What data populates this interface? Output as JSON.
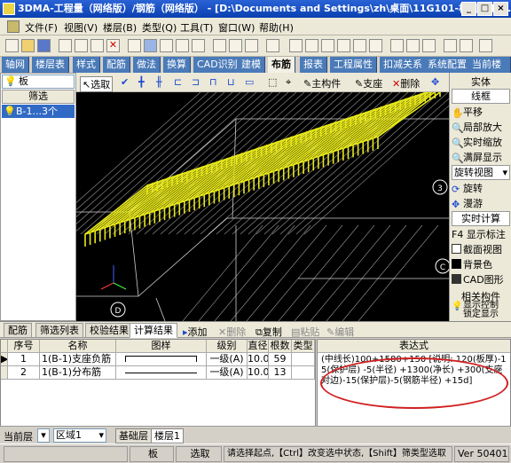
{
  "window": {
    "title": "3DMA-工程量（网络版）/钢筋（网络版） - [D:\\Documents and Settings\\zh\\桌面\\11G101-板测试工程..."
  },
  "menu": [
    "文件(F)",
    "视图(V)",
    "楼层(B)",
    "类型(Q)",
    "工具(T)",
    "窗口(W)",
    "帮助(H)"
  ],
  "tabs": [
    "轴网",
    "楼层表",
    "样式",
    "配筋",
    "做法",
    "换算",
    "CAD识别",
    "建模",
    "布筋",
    "报表",
    "工程属性",
    "扣减关系",
    "系统配置",
    "当前楼"
  ],
  "active_tab": "布筋",
  "left": {
    "combo": "板",
    "filter_label": "筛选",
    "item": "B-1...3个"
  },
  "draw_toolbar": {
    "select": "选取",
    "main_rebar": "主构件",
    "support": "支座",
    "delete": "删除"
  },
  "right_panel": {
    "entity_label": "实体",
    "mode": "线框",
    "tools": [
      "平移",
      "局部放大",
      "实时缩放",
      "满屏显示"
    ],
    "rotate_view": "旋转视图",
    "rotate": "旋转",
    "roam": "漫游",
    "realtime_calc": "实时计算",
    "show_label": "F4 显示标注",
    "section_view": "截面视图",
    "bg_color": "背景色",
    "cad_figure": "CAD图形",
    "related": "相关构件",
    "display_control": "显示控制",
    "lock_display": "锁定显示"
  },
  "viewport": {
    "axis_labels": [
      "3",
      "C",
      "D"
    ]
  },
  "bottom": {
    "tabs": [
      "配筋",
      "筛选列表",
      "校验结果",
      "计算结果"
    ],
    "active_tab": "计算结果",
    "actions": [
      "添加",
      "删除",
      "复制",
      "粘贴",
      "编辑"
    ],
    "columns": [
      "序号",
      "名称",
      "图样",
      "级别",
      "直径",
      "根数",
      "类型"
    ],
    "rows": [
      {
        "no": "1",
        "name": "1(B-1)支座负筋",
        "level": "一级(A)",
        "dia": "10.0",
        "count": "59",
        "type": ""
      },
      {
        "no": "2",
        "name": "1(B-1)分布筋",
        "level": "一级(A)",
        "dia": "10.0",
        "count": "13",
        "type": ""
      }
    ],
    "expr_header": "表达式",
    "expr_text": "(中线长)100+1580+150 [说明: 120(板厚)-15(保护层) -5(半径) +1300(净长) +300(支座对边)-15(保护层)-5(钢筋半径) +15d]"
  },
  "layer_bar": {
    "current_label": "当前层",
    "current_value": "",
    "region": "区域1",
    "tabs": [
      "基础层",
      "楼层1"
    ]
  },
  "status_bar": {
    "type": "板",
    "mode": "选取",
    "hint": "请选择起点,【Ctrl】改变选中状态,【Shift】筛类型选取",
    "version": "Ver 50401"
  },
  "colors": {
    "title_bar": "#0a3fb0",
    "rebar": "#e8e81a",
    "viewport_bg": "#000000",
    "highlight": "#d02020"
  }
}
